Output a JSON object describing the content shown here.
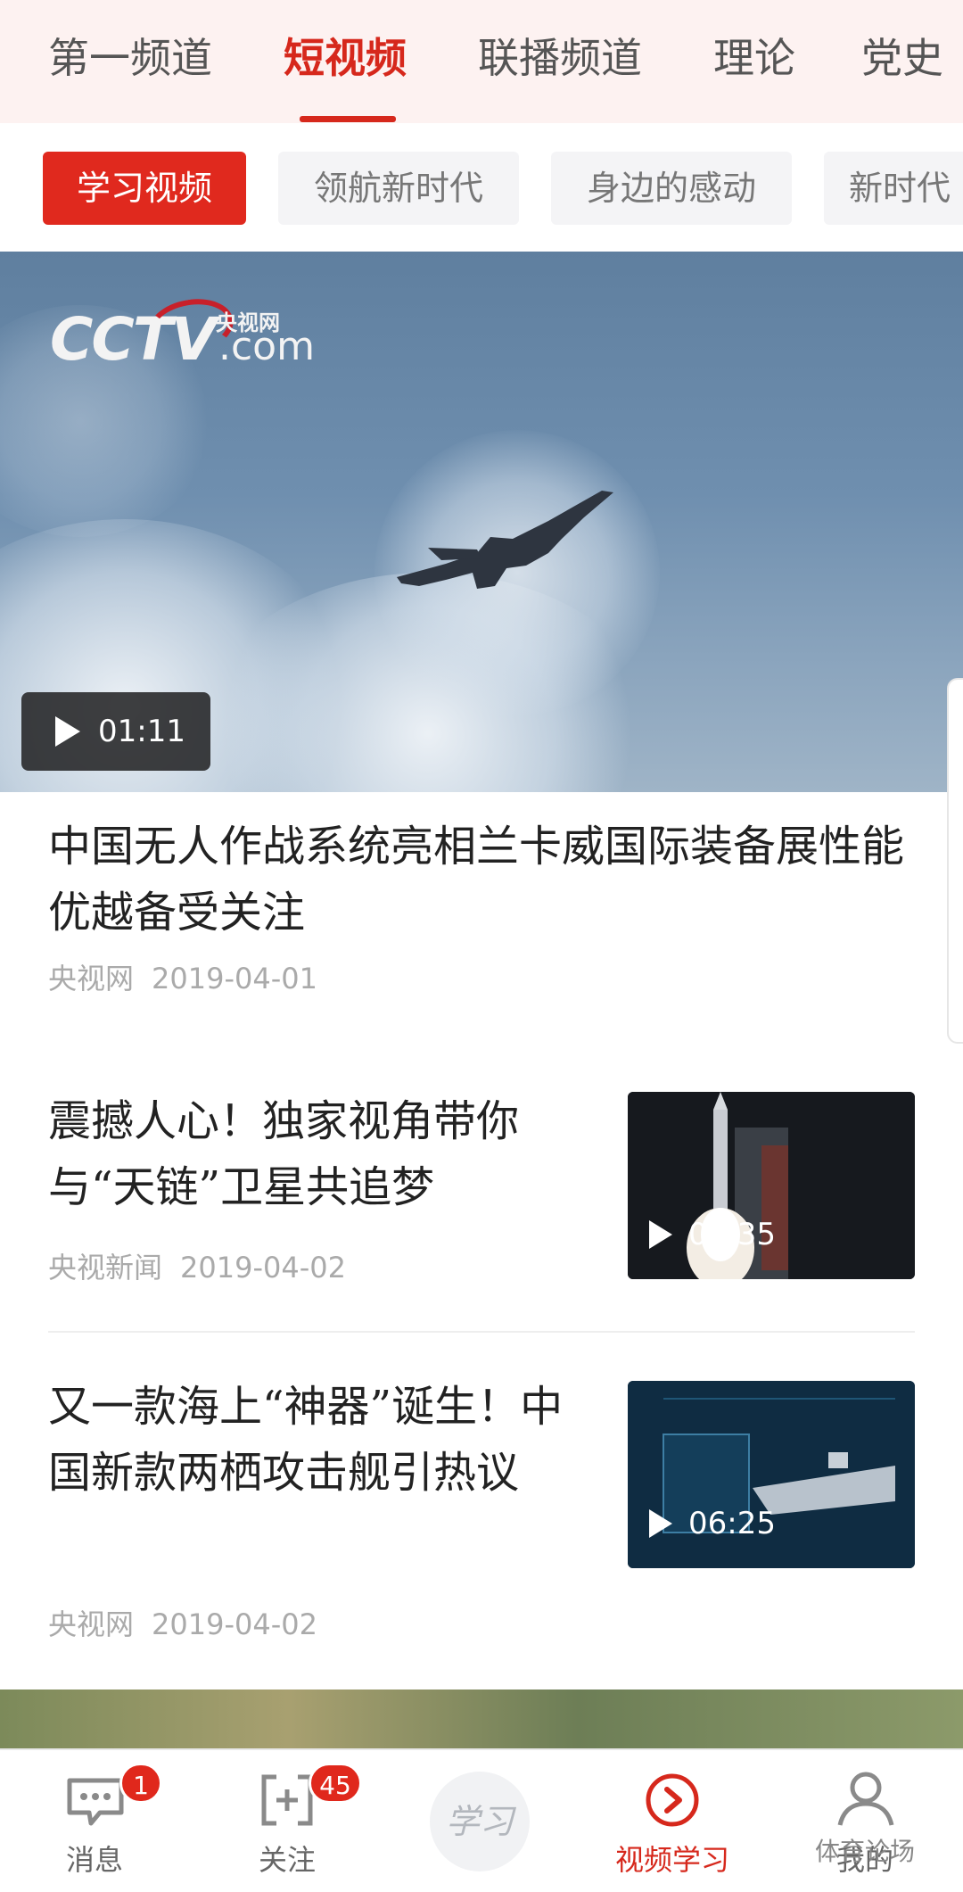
{
  "top_tabs": [
    "第一频道",
    "短视频",
    "联播频道",
    "理论",
    "党史"
  ],
  "sub_tabs": [
    "学习视频",
    "领航新时代",
    "身边的感动",
    "新时代"
  ],
  "featured": {
    "logo_main": "CCTV",
    "logo_com": ".com",
    "logo_cn": "央视网",
    "duration": "01:11",
    "title": "中国无人作战系统亮相兰卡威国际装备展性能优越备受关注",
    "source": "央视网",
    "date": "2019-04-01"
  },
  "items": [
    {
      "title": "震撼人心！独家视角带你与“天链”卫星共追梦",
      "source": "央视新闻",
      "date": "2019-04-02",
      "duration": "01:35"
    },
    {
      "title": "又一款海上“神器”诞生！中国新款两栖攻击舰引热议",
      "source": "央视网",
      "date": "2019-04-02",
      "duration": "06:25"
    }
  ],
  "bottom_nav": {
    "messages": {
      "label": "消息",
      "badge": "1"
    },
    "follow": {
      "label": "关注",
      "badge": "45"
    },
    "center": {
      "logo": "学习"
    },
    "video": {
      "label": "视频学习"
    },
    "me": {
      "label": "我的"
    }
  },
  "watermark": "体育论场",
  "colors": {
    "accent": "#d6281c",
    "active_chip": "#e0291e"
  }
}
